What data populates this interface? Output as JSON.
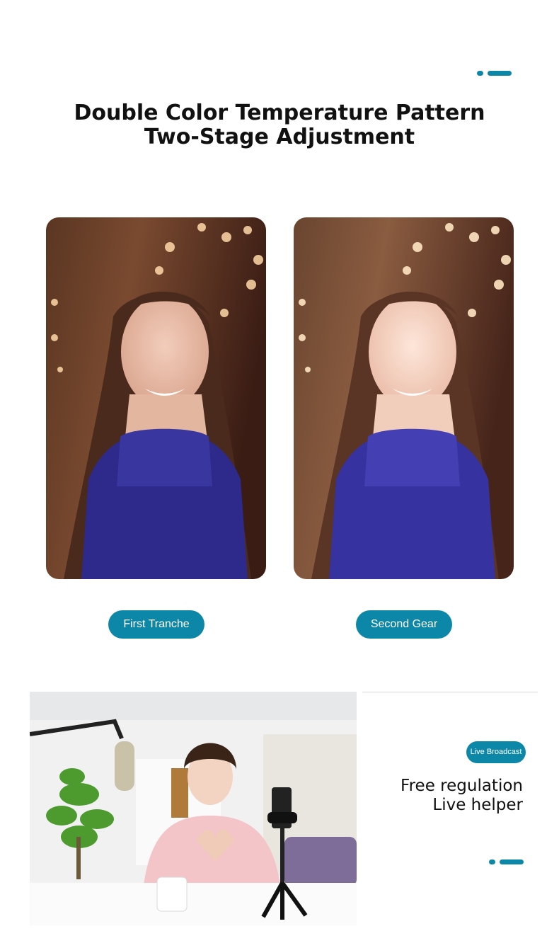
{
  "header": {
    "title_line1": "Double Color Temperature Pattern",
    "title_line2": "Two-Stage Adjustment"
  },
  "comparison": {
    "left_label": "First Tranche",
    "right_label": "Second Gear"
  },
  "feature": {
    "badge": "Live Broadcast",
    "line1": "Free regulation",
    "line2": "Live helper"
  },
  "colors": {
    "accent": "#0d87a8"
  }
}
